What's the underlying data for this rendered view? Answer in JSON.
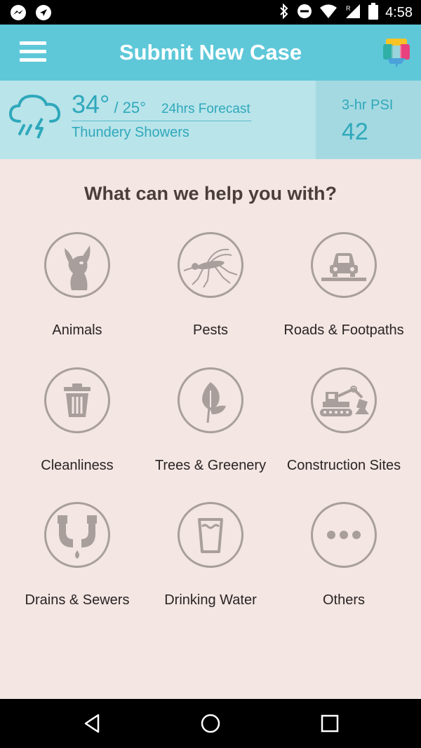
{
  "status_bar": {
    "time": "4:58",
    "icons": [
      "messenger-icon",
      "navigation-icon",
      "bluetooth-icon",
      "do-not-disturb-icon",
      "wifi-icon",
      "signal-icon",
      "battery-icon"
    ],
    "signal_indicator": "R"
  },
  "app_bar": {
    "title": "Submit New Case",
    "menu_icon": "menu-icon",
    "logo_icon": "app-logo-icon"
  },
  "weather": {
    "temp_high": "34°",
    "temp_low": "/ 25°",
    "forecast_label": "24hrs Forecast",
    "condition": "Thundery Showers",
    "psi_label": "3-hr PSI",
    "psi_value": "42",
    "icon": "thunder-rain-icon"
  },
  "main": {
    "question": "What can we help you with?",
    "categories": [
      {
        "label": "Animals",
        "icon": "dog-icon"
      },
      {
        "label": "Pests",
        "icon": "mosquito-icon"
      },
      {
        "label": "Roads & Footpaths",
        "icon": "car-road-icon"
      },
      {
        "label": "Cleanliness",
        "icon": "trash-bin-icon"
      },
      {
        "label": "Trees & Greenery",
        "icon": "leaf-icon"
      },
      {
        "label": "Construction Sites",
        "icon": "excavator-icon"
      },
      {
        "label": "Drains & Sewers",
        "icon": "pipe-drain-icon"
      },
      {
        "label": "Drinking Water",
        "icon": "water-glass-icon"
      },
      {
        "label": "Others",
        "icon": "more-dots-icon"
      }
    ]
  },
  "nav_bar": {
    "back": "back-icon",
    "home": "home-icon",
    "recents": "recents-icon"
  },
  "colors": {
    "app_bar": "#5ec8d9",
    "weather_bg": "#b9e4ea",
    "psi_bg": "#a4d9e1",
    "accent_text": "#2fa8bb",
    "content_bg": "#f3e6e3",
    "icon_gray": "#a89f9c"
  }
}
